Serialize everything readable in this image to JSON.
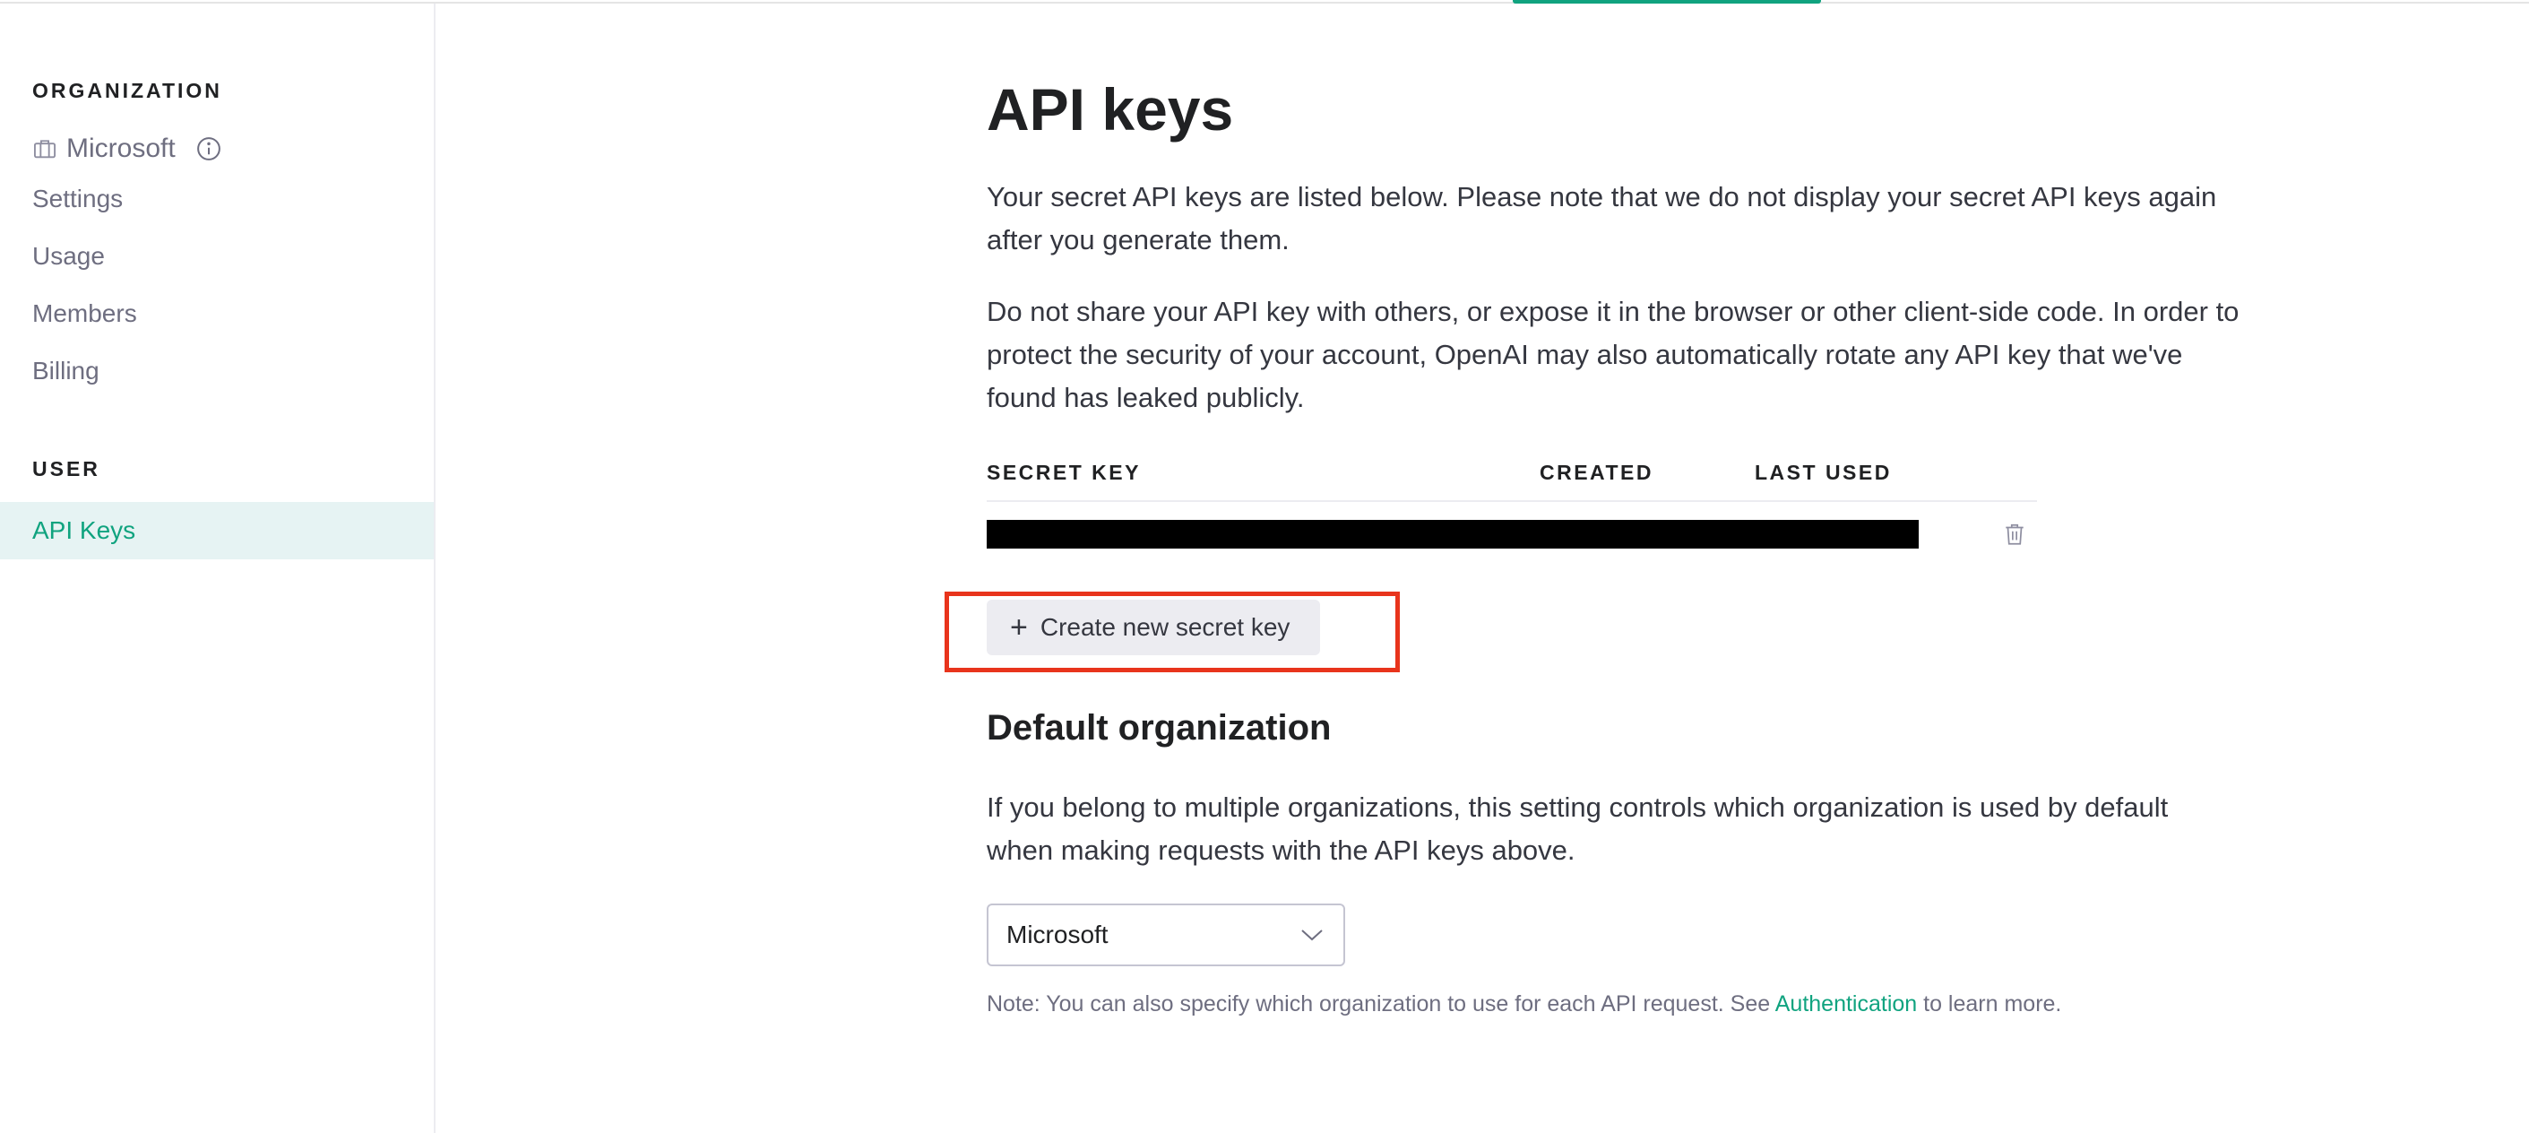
{
  "sidebar": {
    "org_heading": "ORGANIZATION",
    "org_name": "Microsoft",
    "org_items": [
      {
        "label": "Settings"
      },
      {
        "label": "Usage"
      },
      {
        "label": "Members"
      },
      {
        "label": "Billing"
      }
    ],
    "user_heading": "USER",
    "active_item": "API Keys"
  },
  "main": {
    "title": "API keys",
    "para1_line1": "Your secret API keys are listed below. Please note that we do not display your secret API keys again",
    "para1_line2": "after you generate them.",
    "para2_line1": "Do not share your API key with others, or expose it in the browser or other client-side code. In order to",
    "para2_line2": "protect the security of your account, OpenAI may also automatically rotate any API key that we've",
    "para2_line3": "found has leaked publicly.",
    "table": {
      "headers": {
        "secret_key": "SECRET KEY",
        "created": "CREATED",
        "last_used": "LAST USED"
      }
    },
    "create_button": {
      "icon": "+",
      "label": "Create new secret key"
    },
    "default_org": {
      "title": "Default organization",
      "desc_line1": "If you belong to multiple organizations, this setting controls which organization is used by default",
      "desc_line2": "when making requests with the API keys above.",
      "selected": "Microsoft",
      "note_before": "Note: You can also specify which organization to use for each API request. See ",
      "note_link": "Authentication",
      "note_after": " to learn more."
    }
  },
  "colors": {
    "accent": "#10a37f",
    "highlight": "#e8341c"
  }
}
